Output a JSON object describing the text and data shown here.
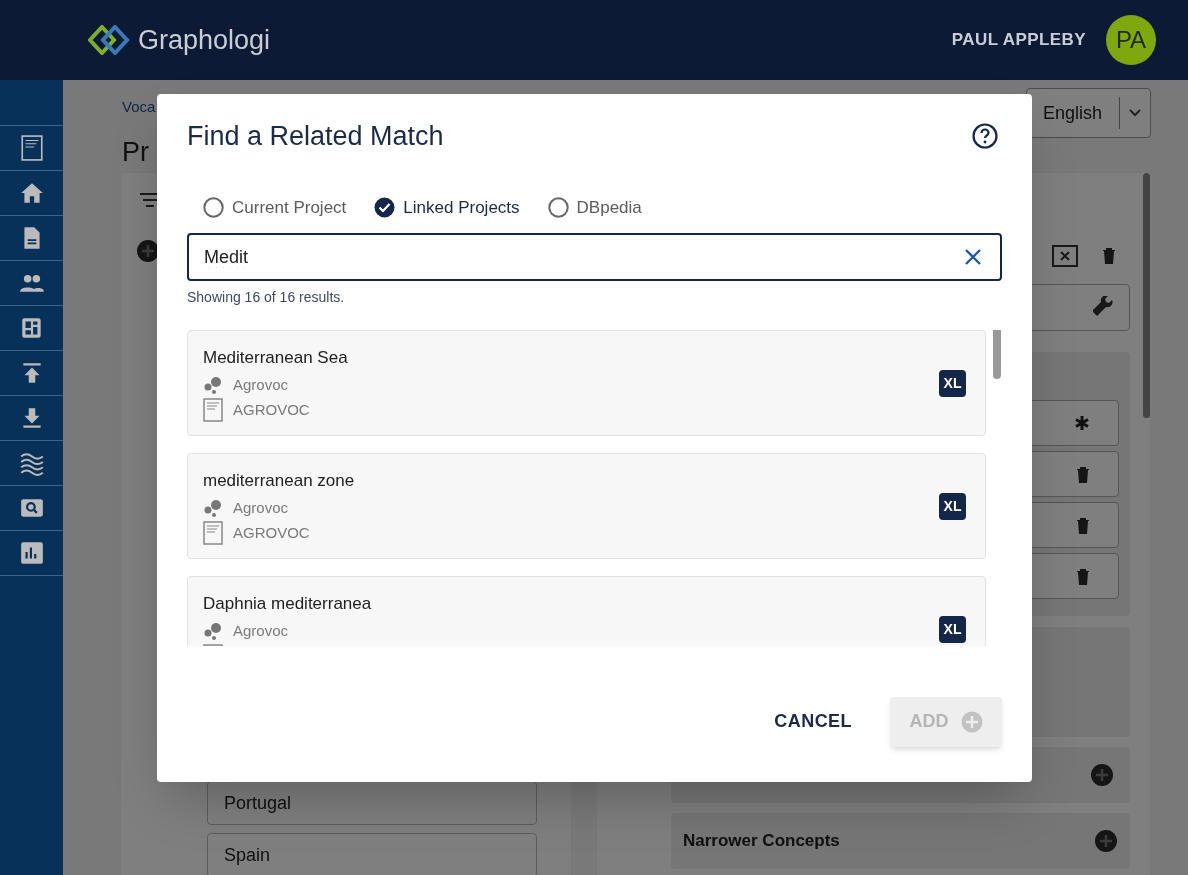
{
  "header": {
    "logo_text": "Graphologi",
    "user_name": "PAUL APPLEBY",
    "avatar_initials": "PA"
  },
  "background": {
    "breadcrumb": "Voca",
    "title": "Pr",
    "language": "English",
    "list_items": [
      "Portugal",
      "Spain"
    ],
    "sections": [
      "Narrower Concepts"
    ]
  },
  "dialog": {
    "title": "Find a Related Match",
    "sources": [
      {
        "label": "Current Project",
        "selected": false
      },
      {
        "label": "Linked Projects",
        "selected": true
      },
      {
        "label": "DBpedia",
        "selected": false
      }
    ],
    "search": {
      "value": "Medit"
    },
    "result_count": "Showing 16 of 16 results.",
    "results": [
      {
        "label": "Mediterranean Sea",
        "project": "Agrovoc",
        "scheme": "AGROVOC",
        "badge": "XL"
      },
      {
        "label": "mediterranean zone",
        "project": "Agrovoc",
        "scheme": "AGROVOC",
        "badge": "XL"
      },
      {
        "label": "Daphnia mediterranea",
        "project": "Agrovoc",
        "badge": "XL"
      }
    ],
    "buttons": {
      "cancel": {
        "label": "CANCEL"
      },
      "add": {
        "label": "ADD",
        "disabled": true
      }
    }
  }
}
